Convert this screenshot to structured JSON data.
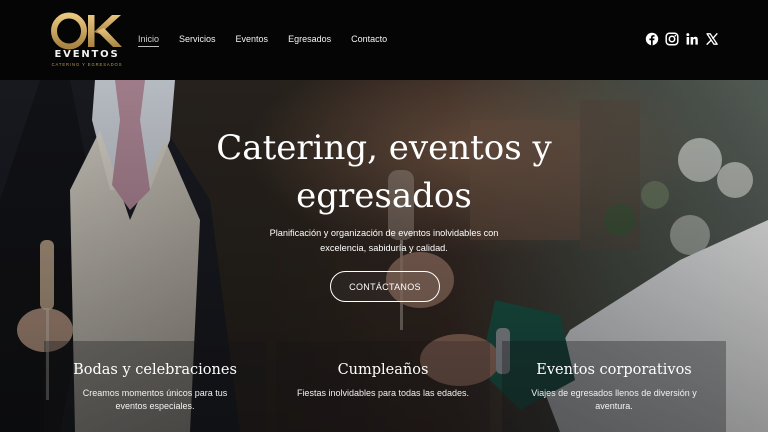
{
  "brand": {
    "logo_mark": "OK",
    "logo_word": "EVENTOS",
    "logo_tagline": "CATERING Y EGRESADOS",
    "colors": {
      "gold": "#c9a45c",
      "header_bg": "#050505"
    }
  },
  "nav": {
    "items": [
      {
        "label": "Inicio",
        "active": true
      },
      {
        "label": "Servicios",
        "active": false
      },
      {
        "label": "Eventos",
        "active": false
      },
      {
        "label": "Egresados",
        "active": false
      },
      {
        "label": "Contacto",
        "active": false
      }
    ]
  },
  "social": [
    "facebook-icon",
    "instagram-icon",
    "linkedin-icon",
    "x-icon"
  ],
  "hero": {
    "title_line1": "Catering, eventos y",
    "title_line2": "egresados",
    "subtitle_line1": "Planificación y organización de eventos inolvidables con",
    "subtitle_line2": "excelencia, sabiduría y calidad.",
    "cta_label": "CONTÁCTANOS"
  },
  "services": [
    {
      "title": "Bodas y celebraciones",
      "desc": "Creamos momentos únicos para tus eventos especiales."
    },
    {
      "title": "Cumpleaños",
      "desc": "Fiestas inolvidables para todas las edades."
    },
    {
      "title": "Eventos corporativos",
      "desc": "Viajes de egresados llenos de diversión y aventura."
    }
  ]
}
